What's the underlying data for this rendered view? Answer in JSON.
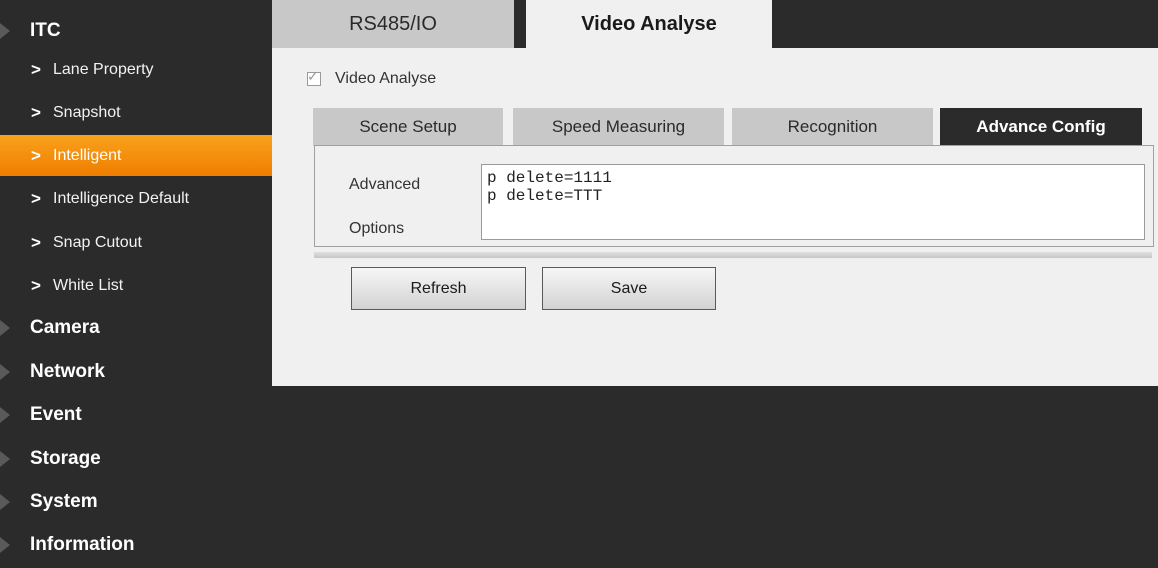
{
  "sidebar": {
    "sections": [
      {
        "label": "ITC",
        "items": [
          {
            "label": "Lane Property",
            "active": false
          },
          {
            "label": "Snapshot",
            "active": false
          },
          {
            "label": "Intelligent",
            "active": true
          },
          {
            "label": "Intelligence Default",
            "active": false
          },
          {
            "label": "Snap Cutout",
            "active": false
          },
          {
            "label": "White List",
            "active": false
          }
        ]
      },
      {
        "label": "Camera"
      },
      {
        "label": "Network"
      },
      {
        "label": "Event"
      },
      {
        "label": "Storage"
      },
      {
        "label": "System"
      },
      {
        "label": "Information"
      }
    ]
  },
  "tabs": {
    "items": [
      "RS485/IO",
      "Video Analyse"
    ],
    "active": "Video Analyse"
  },
  "video_analyse": {
    "checkbox_label": "Video Analyse",
    "checked": true
  },
  "subtabs": {
    "items": [
      "Scene Setup",
      "Speed Measuring",
      "Recognition",
      "Advance Config"
    ],
    "active": "Advance Config"
  },
  "advanced": {
    "label_line1": "Advanced",
    "label_line2": "Options",
    "text_lines": [
      "p delete=1111",
      "p delete=TTT"
    ]
  },
  "buttons": {
    "refresh": "Refresh",
    "save": "Save"
  },
  "colors": {
    "active_item": "#f39200",
    "sidebar_bg": "#2b2b2b",
    "panel_bg": "#f0f0f0",
    "tab_inactive": "#c8c8c8"
  },
  "icons": {
    "category": "triangle-right-icon",
    "subitem": "chevron-right-icon",
    "check": "check-icon"
  }
}
